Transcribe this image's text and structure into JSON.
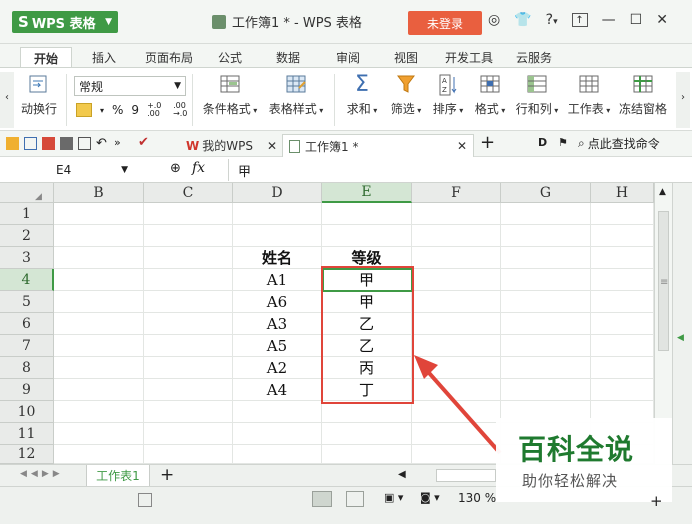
{
  "titlebar": {
    "app_label": "WPS 表格",
    "doc_title": "工作簿1 * - WPS 表格",
    "login_label": "未登录",
    "help_label": "?"
  },
  "menu": {
    "tabs": [
      "开始",
      "插入",
      "页面布局",
      "公式",
      "数据",
      "审阅",
      "视图",
      "开发工具",
      "云服务"
    ]
  },
  "ribbon": {
    "wrap_label": "动换行",
    "number_format": "常规",
    "percent": "%",
    "comma": "9",
    "dec_inc": "+.0 .00",
    "dec_dec": ".00 →.0",
    "cond_format": "条件格式",
    "table_style": "表格样式",
    "sum": "求和",
    "filter": "筛选",
    "sort": "排序",
    "format": "格式",
    "rowcol": "行和列",
    "sheet": "工作表",
    "freeze": "冻结窗格"
  },
  "docbar": {
    "mywps": "我的WPS",
    "workbook": "工作簿1 *",
    "search": "点此查找命令"
  },
  "formula": {
    "cell_ref": "E4",
    "fx": "fx",
    "value": "甲"
  },
  "grid": {
    "columns": [
      "B",
      "C",
      "D",
      "E",
      "F",
      "G",
      "H"
    ],
    "rows": [
      "1",
      "2",
      "3",
      "4",
      "5",
      "6",
      "7",
      "8",
      "9",
      "10",
      "11",
      "12"
    ],
    "header_name": "姓名",
    "header_grade": "等级",
    "names": [
      "A1",
      "A6",
      "A3",
      "A5",
      "A2",
      "A4"
    ],
    "grades": [
      "甲",
      "甲",
      "乙",
      "乙",
      "丙",
      "丁"
    ]
  },
  "sheets": {
    "tab": "工作表1",
    "add": "+"
  },
  "status": {
    "zoom": "130 %"
  },
  "watermark": {
    "title": "百科全说",
    "subtitle": "助你轻松解决"
  },
  "colors": {
    "accent": "#3f9a45",
    "login": "#e95f3f",
    "highlight": "#e0453a"
  }
}
